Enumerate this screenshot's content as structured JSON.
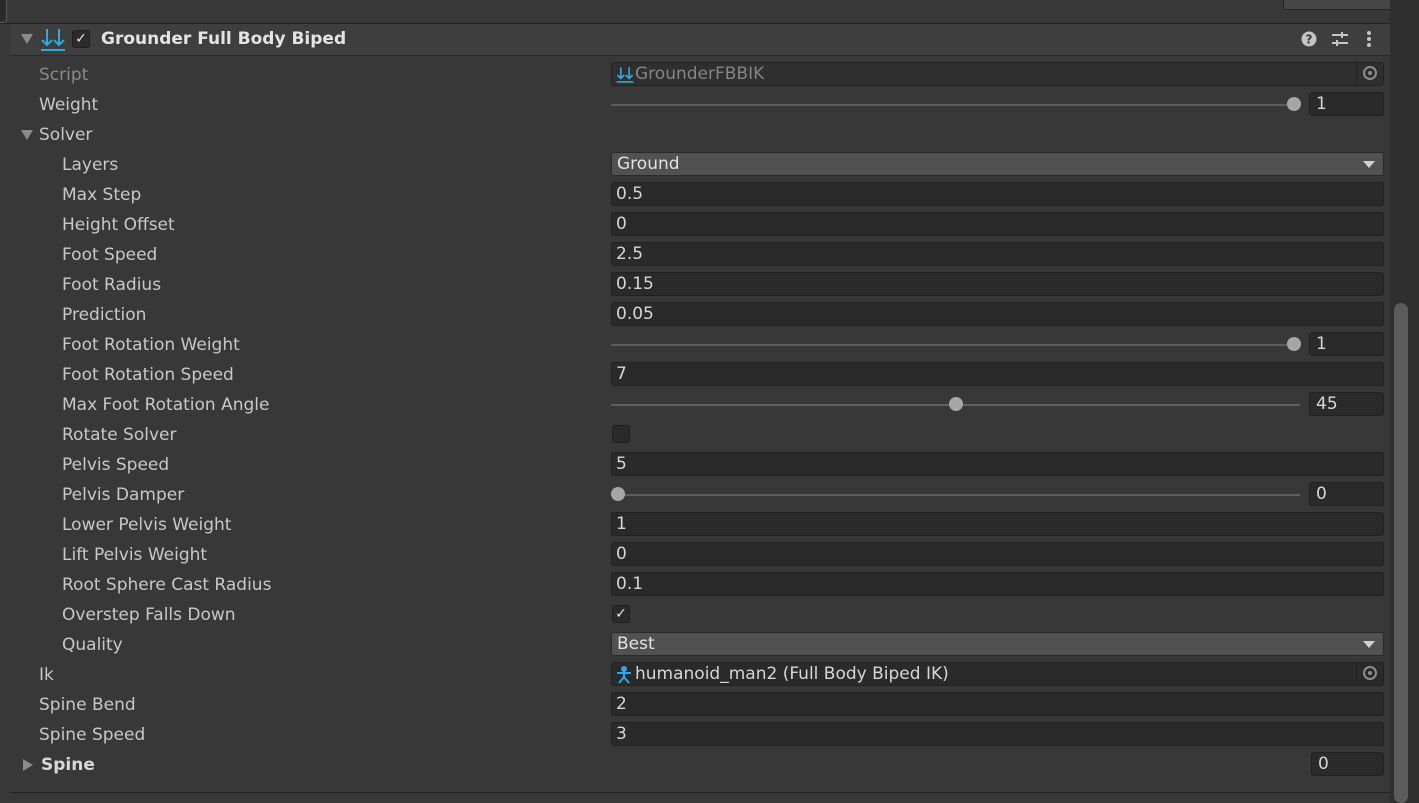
{
  "component": {
    "title": "Grounder Full Body Biped",
    "enabled": true,
    "icons": [
      "grounder-script-icon",
      "help-icon",
      "presets-icon",
      "kebab-menu-icon"
    ]
  },
  "rows": {
    "script": {
      "label": "Script",
      "value": "GrounderFBBIK"
    },
    "weight": {
      "label": "Weight",
      "value": "1",
      "fraction": 1
    },
    "solver": {
      "label": "Solver"
    },
    "layers": {
      "label": "Layers",
      "value": "Ground"
    },
    "max_step": {
      "label": "Max Step",
      "value": "0.5"
    },
    "height_offset": {
      "label": "Height Offset",
      "value": "0"
    },
    "foot_speed": {
      "label": "Foot Speed",
      "value": "2.5"
    },
    "foot_radius": {
      "label": "Foot Radius",
      "value": "0.15"
    },
    "prediction": {
      "label": "Prediction",
      "value": "0.05"
    },
    "foot_rotation_weight": {
      "label": "Foot Rotation Weight",
      "value": "1",
      "fraction": 1
    },
    "foot_rotation_speed": {
      "label": "Foot Rotation Speed",
      "value": "7"
    },
    "max_foot_rotation_angle": {
      "label": "Max Foot Rotation Angle",
      "value": "45",
      "fraction": 0.5
    },
    "rotate_solver": {
      "label": "Rotate Solver",
      "checked": false
    },
    "pelvis_speed": {
      "label": "Pelvis Speed",
      "value": "5"
    },
    "pelvis_damper": {
      "label": "Pelvis Damper",
      "value": "0",
      "fraction": 0
    },
    "lower_pelvis_weight": {
      "label": "Lower Pelvis Weight",
      "value": "1"
    },
    "lift_pelvis_weight": {
      "label": "Lift Pelvis Weight",
      "value": "0"
    },
    "root_sphere_cast_radius": {
      "label": "Root Sphere Cast Radius",
      "value": "0.1"
    },
    "overstep_falls_down": {
      "label": "Overstep Falls Down",
      "checked": true
    },
    "quality": {
      "label": "Quality",
      "value": "Best"
    },
    "ik": {
      "label": "Ik",
      "value": "humanoid_man2 (Full Body Biped IK)"
    },
    "spine_bend": {
      "label": "Spine Bend",
      "value": "2"
    },
    "spine_speed": {
      "label": "Spine Speed",
      "value": "3"
    },
    "spine": {
      "label": "Spine",
      "value": "0"
    }
  },
  "colors": {
    "accent_icon": "#2fa9e0",
    "background": "#383838",
    "field": "#2a2a2a"
  }
}
